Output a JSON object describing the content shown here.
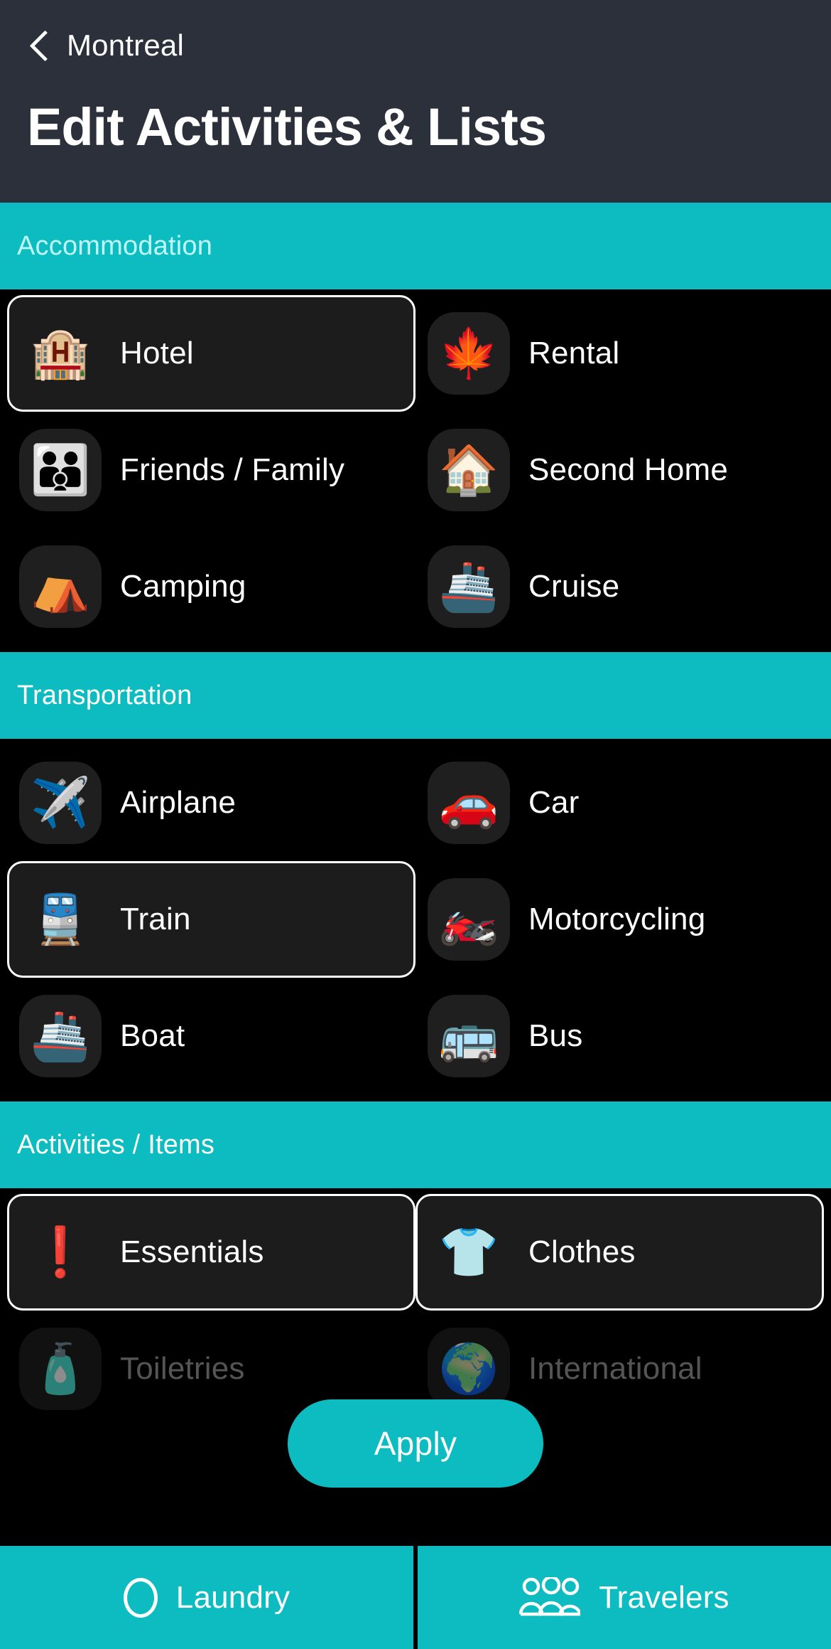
{
  "header": {
    "back_icon": "chevron-left-icon",
    "back_label": "Montreal",
    "title": "Edit Activities & Lists"
  },
  "colors": {
    "accent": "#0cbcc0",
    "header_bg": "#2b303a",
    "page_bg": "#000000",
    "selected_border": "#ffffff",
    "selected_fill": "#1c1c1c",
    "icon_bg": "#1f1f1f",
    "section_title": "#bff6f7"
  },
  "sections": [
    {
      "title": "Accommodation",
      "title_style": "light",
      "rows": [
        [
          {
            "label": "Hotel",
            "icon": "hotel-icon",
            "glyph": "🏨",
            "selected": true
          },
          {
            "label": "Rental",
            "icon": "rental-icon",
            "glyph": "🍁",
            "selected": false
          }
        ],
        [
          {
            "label": "Friends / Family",
            "icon": "family-icon",
            "glyph": "👪",
            "selected": false
          },
          {
            "label": "Second Home",
            "icon": "second-home-icon",
            "glyph": "🏠",
            "selected": false
          }
        ],
        [
          {
            "label": "Camping",
            "icon": "camping-icon",
            "glyph": "⛺",
            "selected": false
          },
          {
            "label": "Cruise",
            "icon": "cruise-icon",
            "glyph": "🚢",
            "selected": false
          }
        ]
      ]
    },
    {
      "title": "Transportation",
      "title_style": "white",
      "rows": [
        [
          {
            "label": "Airplane",
            "icon": "airplane-icon",
            "glyph": "✈️",
            "selected": false
          },
          {
            "label": "Car",
            "icon": "car-icon",
            "glyph": "🚗",
            "selected": false
          }
        ],
        [
          {
            "label": "Train",
            "icon": "train-icon",
            "glyph": "🚆",
            "selected": true
          },
          {
            "label": "Motorcycling",
            "icon": "motorcycle-icon",
            "glyph": "🏍️",
            "selected": false
          }
        ],
        [
          {
            "label": "Boat",
            "icon": "boat-icon",
            "glyph": "🚢",
            "selected": false
          },
          {
            "label": "Bus",
            "icon": "bus-icon",
            "glyph": "🚌",
            "selected": false
          }
        ]
      ]
    },
    {
      "title": "Activities / Items",
      "title_style": "white",
      "rows": [
        [
          {
            "label": "Essentials",
            "icon": "essentials-icon",
            "glyph": "❗",
            "selected": true
          },
          {
            "label": "Clothes",
            "icon": "clothes-icon",
            "glyph": "👕",
            "selected": true
          }
        ],
        [
          {
            "label": "Toiletries",
            "icon": "toiletries-icon",
            "glyph": "🧴",
            "selected": false,
            "faded": true
          },
          {
            "label": "International",
            "icon": "international-icon",
            "glyph": "🌍",
            "selected": false,
            "faded": true
          }
        ]
      ]
    }
  ],
  "apply": {
    "label": "Apply"
  },
  "bottom_nav": [
    {
      "label": "Laundry",
      "icon": "circle-icon"
    },
    {
      "label": "Travelers",
      "icon": "people-group-icon"
    }
  ]
}
